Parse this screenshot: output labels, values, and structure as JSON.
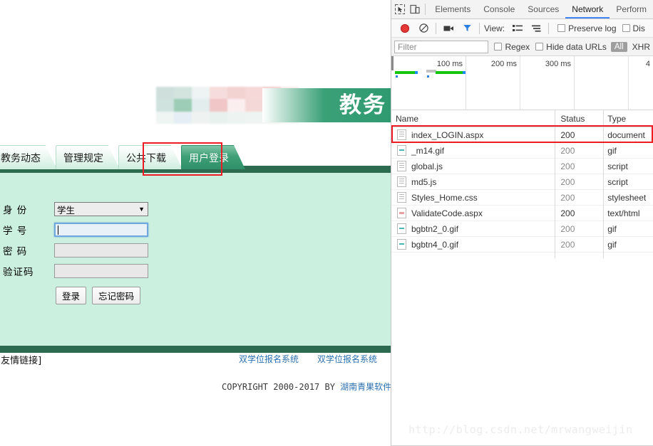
{
  "webpage": {
    "banner_title": "教务",
    "nav_tabs": [
      {
        "label": "教务动态",
        "active": false
      },
      {
        "label": "管理规定",
        "active": false
      },
      {
        "label": "公共下载",
        "active": false
      },
      {
        "label": "用户登录",
        "active": true
      }
    ],
    "login_form": {
      "identity_label": "身  份",
      "identity_value": "学生",
      "identity_options": [
        "学生"
      ],
      "student_id_label": "学  号",
      "student_id_value": "",
      "password_label": "密  码",
      "password_value": "",
      "captcha_label": "验证码",
      "captcha_value": "",
      "login_button": "登录",
      "forgot_button": "忘记密码"
    },
    "footer": {
      "friendly_links_label": "[友情链接]",
      "link1": "双学位报名系统",
      "link2": "双学位报名系统",
      "copyright_prefix": "COPYRIGHT 2000-2017 BY ",
      "copyright_company": "湖南青果软件有限"
    }
  },
  "devtools": {
    "left_icons": [
      {
        "name": "inspect-element-icon"
      },
      {
        "name": "device-toolbar-icon"
      }
    ],
    "tabs": [
      {
        "label": "Elements",
        "active": false
      },
      {
        "label": "Console",
        "active": false
      },
      {
        "label": "Sources",
        "active": false
      },
      {
        "label": "Network",
        "active": true
      },
      {
        "label": "Perform",
        "active": false
      }
    ],
    "toolbar": {
      "record_icon": "record-button-icon",
      "clear_icon": "clear-icon",
      "camera_icon": "capture-screenshots-icon",
      "filter_icon": "filter-icon",
      "view_label": "View:",
      "list_view_icon": "list-view-icon",
      "waterfall_view_icon": "waterfall-view-icon",
      "preserve_log_label": "Preserve log",
      "preserve_log_checked": false,
      "disable_cache_label": "Dis",
      "disable_cache_checked": false
    },
    "filterbar": {
      "filter_placeholder": "Filter",
      "filter_value": "",
      "regex_label": "Regex",
      "regex_checked": false,
      "hide_data_urls_label": "Hide data URLs",
      "hide_data_urls_checked": false,
      "type_all": "All",
      "type_xhr": "XHR"
    },
    "timeline": {
      "ticks": [
        "100 ms",
        "200 ms",
        "300 ms",
        "4"
      ],
      "tick_x": [
        104,
        180,
        256,
        332
      ]
    },
    "table": {
      "columns": [
        "Name",
        "Status",
        "Type"
      ],
      "rows": [
        {
          "name": "index_LOGIN.aspx",
          "status": "200",
          "type": "document",
          "icon": "document-file-icon",
          "highlighted": true
        },
        {
          "name": "_m14.gif",
          "status": "200",
          "type": "gif",
          "icon": "image-file-icon",
          "highlighted": false
        },
        {
          "name": "global.js",
          "status": "200",
          "type": "script",
          "icon": "document-file-icon",
          "highlighted": false
        },
        {
          "name": "md5.js",
          "status": "200",
          "type": "script",
          "icon": "document-file-icon",
          "highlighted": false
        },
        {
          "name": "Styles_Home.css",
          "status": "200",
          "type": "stylesheet",
          "icon": "document-file-icon",
          "highlighted": false
        },
        {
          "name": "ValidateCode.aspx",
          "status": "200",
          "type": "text/html",
          "icon": "image-pink-file-icon",
          "highlighted": false
        },
        {
          "name": "bgbtn2_0.gif",
          "status": "200",
          "type": "gif",
          "icon": "image-file-icon",
          "highlighted": false
        },
        {
          "name": "bgbtn4_0.gif",
          "status": "200",
          "type": "gif",
          "icon": "image-file-icon",
          "highlighted": false
        }
      ]
    },
    "watermark": "http://blog.csdn.net/mrwangweijin"
  },
  "colors": {
    "accent_green": "#2c6b50",
    "page_bg": "#ccf0df",
    "annotation_red": "#ee1c24",
    "devtools_blue": "#4285f4",
    "record_red": "#e53935",
    "link_blue": "#2a6fae"
  }
}
